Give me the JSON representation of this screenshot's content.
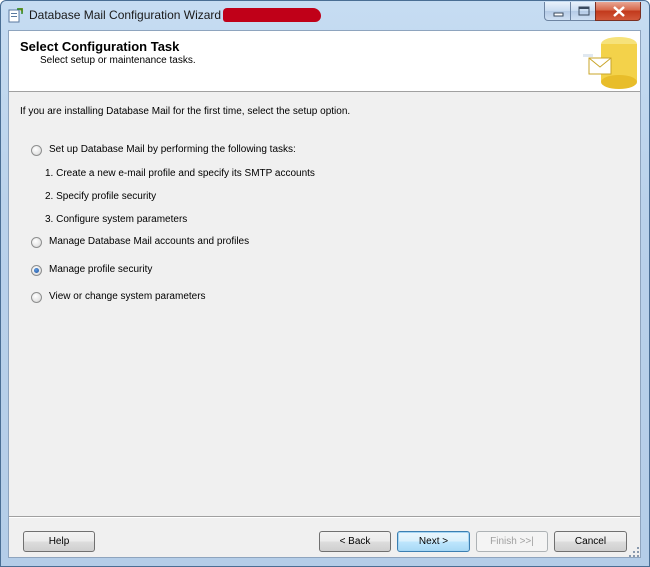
{
  "window": {
    "title": "Database Mail Configuration Wizard",
    "icons": {
      "app": "wizard-app-icon",
      "minimize": "minimize-icon",
      "maximize": "maximize-icon",
      "close": "close-icon"
    }
  },
  "header": {
    "title": "Select Configuration Task",
    "subtitle": "Select setup or maintenance tasks.",
    "graphic": "database-mail-graphic"
  },
  "intro_text": "If you are installing Database Mail for the first time, select the setup option.",
  "options": [
    {
      "label": "Set up Database Mail by performing the following tasks:",
      "checked": false
    },
    {
      "label": "Manage Database Mail accounts and profiles",
      "checked": false
    },
    {
      "label": "Manage profile security",
      "checked": true
    },
    {
      "label": "View or change system parameters",
      "checked": false
    }
  ],
  "setup_tasks": [
    "1. Create a new e-mail profile and specify its SMTP accounts",
    "2. Specify profile security",
    "3. Configure system parameters"
  ],
  "buttons": {
    "help": "Help",
    "back": "< Back",
    "next": "Next >",
    "finish": "Finish >>|",
    "cancel": "Cancel"
  },
  "colors": {
    "accent": "#3c7fb1",
    "close": "#c2391c",
    "redaction": "#c00018"
  }
}
